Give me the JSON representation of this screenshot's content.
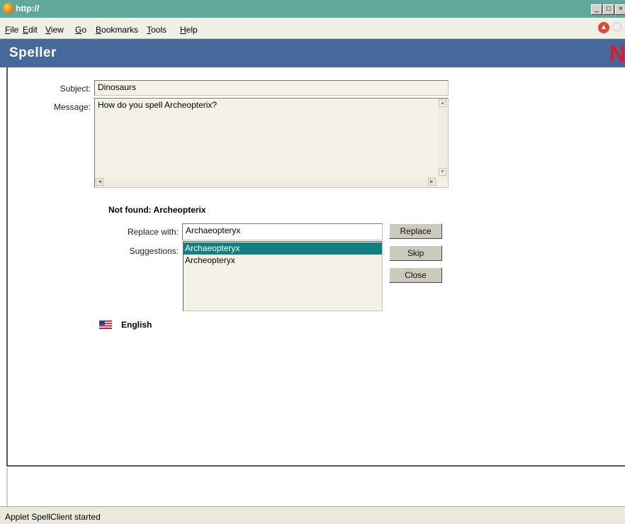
{
  "window": {
    "title": "http://",
    "controls": {
      "minimize": "_",
      "maximize": "□",
      "close": "×"
    }
  },
  "menu": {
    "items": [
      {
        "label": "File",
        "underline": "F",
        "rest": "ile"
      },
      {
        "label": "Edit",
        "underline": "E",
        "rest": "dit"
      },
      {
        "label": "View",
        "underline": "V",
        "rest": "iew"
      },
      {
        "label": "Go",
        "underline": "G",
        "rest": "o"
      },
      {
        "label": "Bookmarks",
        "underline": "B",
        "rest": "ookmarks"
      },
      {
        "label": "Tools",
        "underline": "T",
        "rest": "ools"
      },
      {
        "label": "Help",
        "underline": "H",
        "rest": "elp"
      }
    ]
  },
  "header": {
    "title": "Speller",
    "logo": "N",
    "accent": "#46699b",
    "logo_color": "#e11b22"
  },
  "form": {
    "subject_label": "Subject:",
    "subject_value": "Dinosaurs",
    "message_label": "Message:",
    "message_value": "How do you spell Archeopterix?"
  },
  "speller": {
    "not_found_label": "Not found:",
    "not_found_word": "Archeopterix",
    "replace_label": "Replace with:",
    "replace_value": "Archaeopteryx",
    "suggestions_label": "Suggestions:",
    "suggestions": [
      "Archaeopteryx",
      "Archeopteryx"
    ],
    "selected_index": 0,
    "buttons": {
      "replace": "Replace",
      "skip": "Skip",
      "close": "Close"
    },
    "language": "English",
    "selection_color": "#118080"
  },
  "status": {
    "text": "Applet SpellClient started"
  }
}
